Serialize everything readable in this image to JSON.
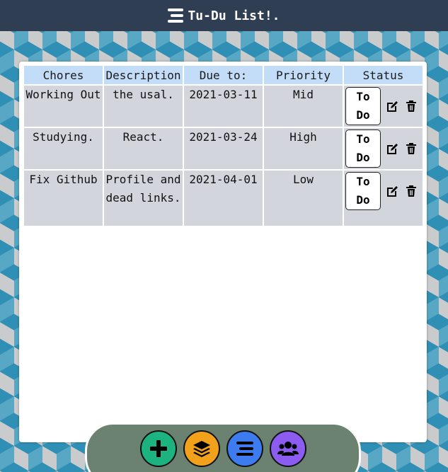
{
  "header": {
    "title": "Tu-Du List!.",
    "icon": "list-icon"
  },
  "table": {
    "columns": [
      "Chores",
      "Description",
      "Due to:",
      "Priority",
      "Status"
    ],
    "rows": [
      {
        "chore": "Working Out",
        "description": "the usal.",
        "due": "2021-03-11",
        "priority": "Mid",
        "status": "To Do"
      },
      {
        "chore": "Studying.",
        "description": "React.",
        "due": "2021-03-24",
        "priority": "High",
        "status": "To Do"
      },
      {
        "chore": "Fix Github",
        "description": "Profile and dead links.",
        "due": "2021-04-01",
        "priority": "Low",
        "status": "To Do"
      }
    ]
  },
  "dock": {
    "buttons": [
      {
        "icon": "plus-icon",
        "color": "#1db381"
      },
      {
        "icon": "layers-icon",
        "color": "#f2a11a"
      },
      {
        "icon": "list-icon",
        "color": "#3d7cf0"
      },
      {
        "icon": "users-icon",
        "color": "#8c5cf0"
      }
    ]
  },
  "colors": {
    "header_bg": "#2f3e52",
    "header_cell": "#c3dcf7",
    "body_cell": "#d2d5dc",
    "dock_bg": "#6b8270"
  }
}
